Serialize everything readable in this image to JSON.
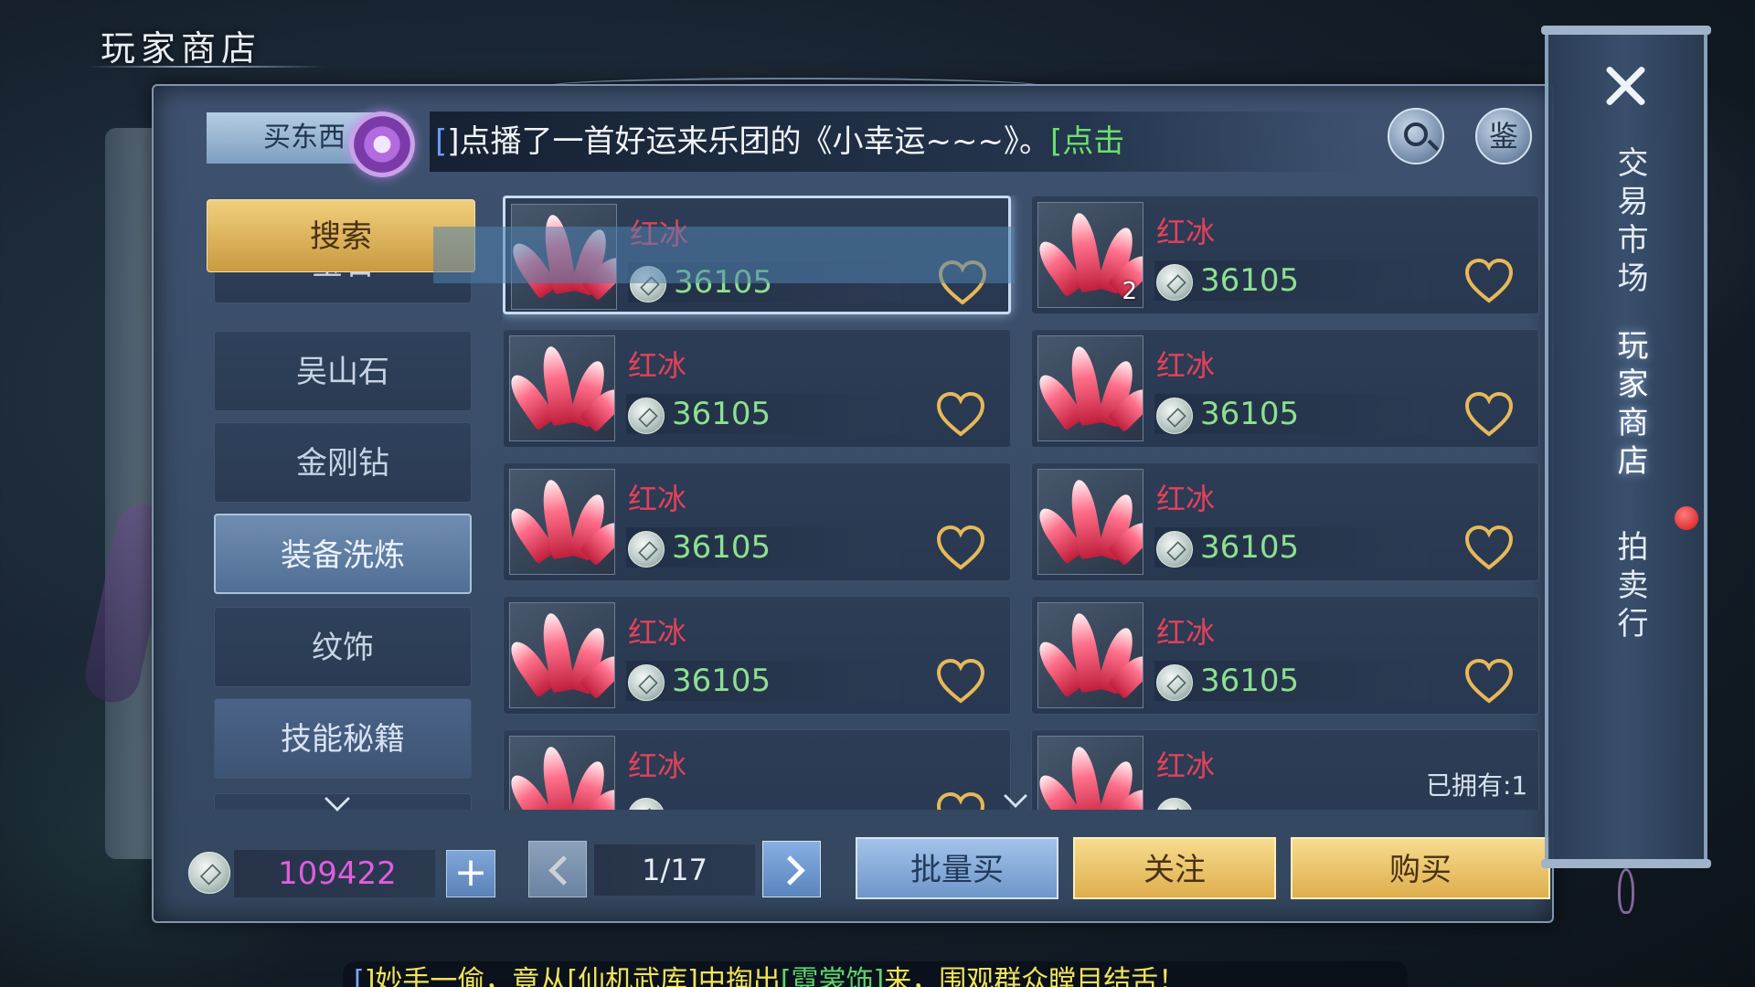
{
  "screen_title": "玩家商店",
  "header": {
    "buy_tab": "买东西",
    "marquee": {
      "part1": "[",
      "part2": "]点播了一首好运来乐团的《小幸运~~~》。",
      "part3": "[点击"
    },
    "search_button": "search-icon",
    "appraise_button": "鉴"
  },
  "sidebar": {
    "search_label": "搜索",
    "items": [
      {
        "label": "宝石"
      },
      {
        "label": "吴山石"
      },
      {
        "label": "金刚钻"
      },
      {
        "label": "装备洗炼"
      },
      {
        "label": "纹饰"
      },
      {
        "label": "技能秘籍"
      }
    ]
  },
  "items": [
    {
      "name": "红冰",
      "price": "36105",
      "qty": ""
    },
    {
      "name": "红冰",
      "price": "36105",
      "qty": "2"
    },
    {
      "name": "红冰",
      "price": "36105",
      "qty": ""
    },
    {
      "name": "红冰",
      "price": "36105",
      "qty": ""
    },
    {
      "name": "红冰",
      "price": "36105",
      "qty": ""
    },
    {
      "name": "红冰",
      "price": "36105",
      "qty": ""
    },
    {
      "name": "红冰",
      "price": "36105",
      "qty": ""
    },
    {
      "name": "红冰",
      "price": "36105",
      "qty": ""
    },
    {
      "name": "红冰",
      "price": "",
      "qty": ""
    },
    {
      "name": "红冰",
      "price": "",
      "qty": ""
    }
  ],
  "owned_text": "已拥有:1",
  "footer": {
    "balance": "109422",
    "page": "1/17",
    "bulk_buy": "批量买",
    "follow": "关注",
    "buy": "购买"
  },
  "right_tabs": {
    "trade_market": "交易市场",
    "player_shop": "玩家商店",
    "auction": "拍卖行"
  },
  "ticker": {
    "part1": "[",
    "part2": "]妙手一偷，竟从[仙机武库]中掏出",
    "part3": "[霓裳饰]",
    "part4": "来，围观群众瞠目结舌！"
  },
  "colors": {
    "item_name": "#e5415a",
    "price": "#8de090",
    "balance": "#e05de0",
    "gold_button": "#deae4d",
    "blue_button": "#6e96c9"
  }
}
